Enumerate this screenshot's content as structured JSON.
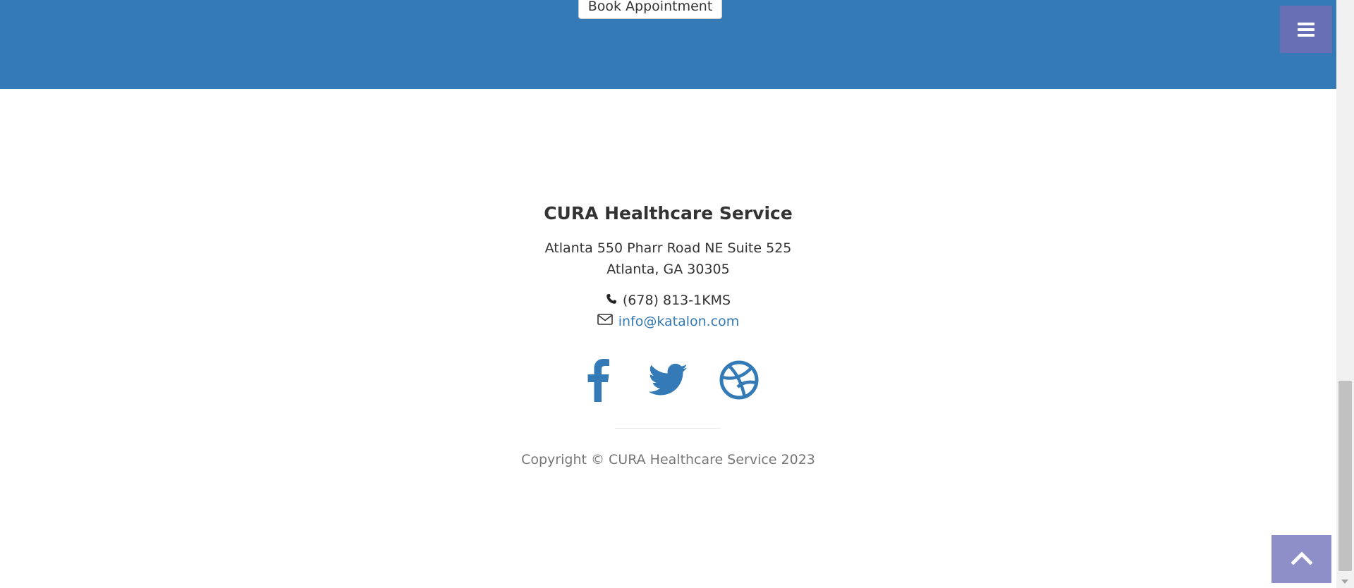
{
  "header": {
    "book_button_label": "Book Appointment",
    "menu_icon": "hamburger-menu-icon"
  },
  "footer": {
    "title": "CURA Healthcare Service",
    "address_line1": "Atlanta 550 Pharr Road NE Suite 525",
    "address_line2": "Atlanta, GA 30305",
    "phone": "(678) 813-1KMS",
    "phone_icon": "phone-icon",
    "email": "info@katalon.com",
    "email_icon": "envelope-icon",
    "social": [
      {
        "name": "facebook",
        "icon": "facebook-icon"
      },
      {
        "name": "twitter",
        "icon": "twitter-icon"
      },
      {
        "name": "dribbble",
        "icon": "dribbble-icon"
      }
    ],
    "copyright": "Copyright © CURA Healthcare Service 2023"
  },
  "to_top_icon": "chevron-up-icon",
  "colors": {
    "brand_blue": "#337ab7",
    "menu_toggle": "#6e6eb4",
    "to_top": "#8e8ec8",
    "muted_text": "#777777"
  }
}
